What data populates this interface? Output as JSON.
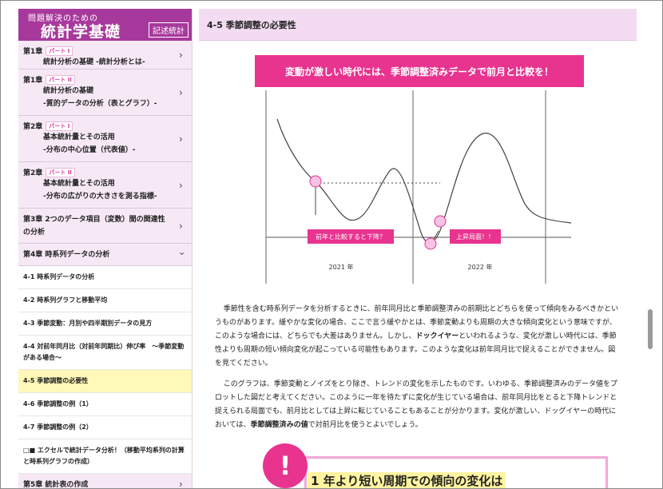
{
  "brand": {
    "top": "問題解決のための",
    "main": "統計学基礎",
    "badge": "記述統計"
  },
  "sidebar": {
    "chapters": [
      {
        "chapter": "第1章",
        "part": "パート I",
        "lines": [
          "統計分析の基礎 -統計分析とは-"
        ]
      },
      {
        "chapter": "第1章",
        "part": "パート II",
        "lines": [
          "統計分析の基礎",
          "-質的データの分析（表とグラフ）-"
        ]
      },
      {
        "chapter": "第2章",
        "part": "パート I",
        "lines": [
          "基本統計量とその活用",
          "-分布の中心位置（代表値）-"
        ]
      },
      {
        "chapter": "第2章",
        "part": "パート II",
        "lines": [
          "基本統計量とその活用",
          "-分布の広がりの大きさを測る指標-"
        ]
      }
    ],
    "chapter3": {
      "line1": "第3章 2つのデータ項目（変数）間の関連性",
      "line2": "の分析"
    },
    "chapter4": {
      "label": "第4章 時系列データの分析"
    },
    "sub_items": [
      "4-1 時系列データの分析",
      "4-2 時系列グラフと移動平均",
      "4-3 季節変動：月別や四半期別データの見方",
      "4-4 対前年同月比（対前年同期比）伸び率　〜季節変動がある場合〜",
      "4-5 季節調整の必要性",
      "4-6 季節調整の例（1）",
      "4-7 季節調整の例（2）",
      "□■ エクセルで統計データ分析！（移動平均系列の計算と時系列グラフの作成）"
    ],
    "active_index": 4,
    "chapter5": {
      "label": "第5章 統計表の作成"
    }
  },
  "main": {
    "title": "4-5  季節調整の必要性",
    "figure": {
      "banner": "変動が激しい時代には、季節調整済みデータで前月と比較を！",
      "label_down": "前年と比較すると下降？",
      "label_up": "上昇局面！！",
      "year1": "2021 年",
      "year2": "2022 年"
    },
    "para1_parts": [
      "季節性を含む時系列データを分析するときに、前年同月比と季節調整済みの前期比とどちらを使って傾向をみるべきかというものがあります。緩やかな変化の場合、ここで言う緩やかとは、季節変動よりも周期の大きな傾向変化という意味ですが、このような場合には、どちらでも大差はありません。しかし、",
      "ドックイヤー",
      "といわれるような、変化が激しい時代には、季節性よりも周期の短い傾向変化が起こっている可能性もあります。このような変化は前年同月比で捉えることができません。図を見てください。"
    ],
    "para2_parts": [
      "このグラフは、季節変動とノイズをとり除き、トレンドの変化を示したものです。いわゆる、季節調整済みのデータ値をプロットした図だと考えてください。このように一年を待たずに変化が生じている場合は、前年同月比をとると下降トレンドと捉えられる局面でも、前月比としては上昇に転じていることもあることが分かります。変化が激しい、ドッグイヤーの時代においては、",
      "季節調整済みの値",
      "で対前月比を使うとよいでしょう。"
    ],
    "callout": {
      "mark": "!",
      "title": "1 年より短い周期での傾向の変化は"
    }
  },
  "colors": {
    "brand": "#a8399c",
    "accent_pink": "#e8338f",
    "sidebar_bg": "#f6e9f5",
    "active_bg": "#fff8b8"
  }
}
